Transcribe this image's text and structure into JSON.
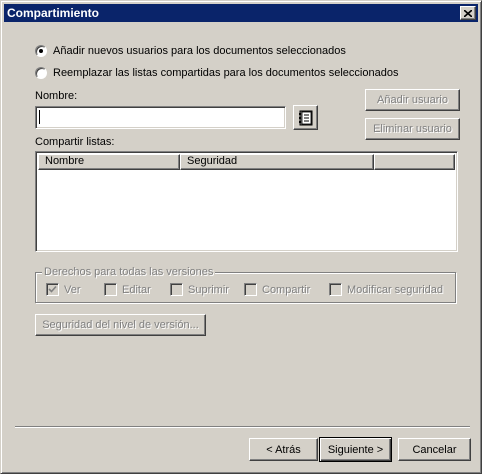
{
  "window": {
    "title": "Compartimiento"
  },
  "options": {
    "add_users": {
      "label": "Añadir nuevos usuarios para los documentos seleccionados",
      "selected": true
    },
    "replace_lists": {
      "label": "Reemplazar las listas compartidas para los documentos seleccionados",
      "selected": false
    }
  },
  "name_field": {
    "label": "Nombre:",
    "value": ""
  },
  "buttons": {
    "add_user": "Añadir usuario",
    "remove_user": "Eliminar usuario",
    "version_security": "Seguridad del nivel de versión...",
    "back": "< Atrás",
    "next": "Siguiente >",
    "cancel": "Cancelar"
  },
  "share_list": {
    "label": "Compartir listas:",
    "columns": [
      "Nombre",
      "Seguridad",
      ""
    ],
    "rows": []
  },
  "rights": {
    "group_title": "Derechos para todas las versiones",
    "items": [
      {
        "label": "Ver",
        "checked": true
      },
      {
        "label": "Editar",
        "checked": false
      },
      {
        "label": "Suprimir",
        "checked": false
      },
      {
        "label": "Compartir",
        "checked": false
      },
      {
        "label": "Modificar seguridad",
        "checked": false
      }
    ]
  },
  "icons": {
    "close": "close-icon",
    "address_book": "address-book-icon"
  },
  "colors": {
    "titlebar": "#0a246a",
    "face": "#d4d0c8",
    "disabled_text": "#808080"
  }
}
